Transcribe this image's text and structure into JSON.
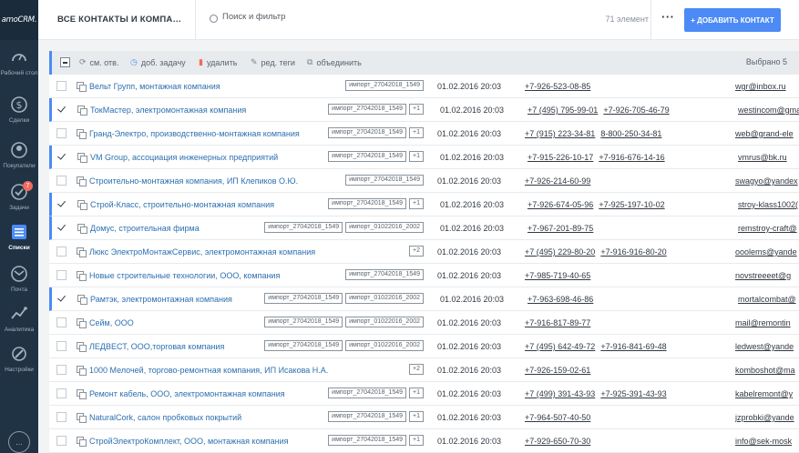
{
  "sidebar": {
    "logo": "amoCRM.",
    "items": [
      {
        "label": "Рабочий стол",
        "icon": "speedometer-icon"
      },
      {
        "label": "Сделки",
        "icon": "dollar-icon"
      },
      {
        "label": "Покупатели",
        "icon": "customer-icon"
      },
      {
        "label": "Задачи",
        "icon": "tasks-check-icon",
        "badge": "7"
      },
      {
        "label": "Списки",
        "icon": "lists-icon",
        "active": true
      },
      {
        "label": "Почта",
        "icon": "mail-icon"
      },
      {
        "label": "Аналитика",
        "icon": "analytics-icon"
      },
      {
        "label": "Настройки",
        "icon": "settings-icon"
      }
    ],
    "chat": "..."
  },
  "header": {
    "title": "ВСЕ КОНТАКТЫ И КОМПАНИИ",
    "search_placeholder": "Поиск и фильтр",
    "count": "71 элемент",
    "more": "···",
    "add_button": "+ ДОБАВИТЬ КОНТАКТ"
  },
  "actions": {
    "items": [
      {
        "label": "см. отв.",
        "icon": "refresh-icon"
      },
      {
        "label": "доб. задачу",
        "icon": "clock-icon"
      },
      {
        "label": "удалить",
        "icon": "trash-icon"
      },
      {
        "label": "ред. теги",
        "icon": "tag-icon"
      },
      {
        "label": "объединить",
        "icon": "merge-icon"
      }
    ],
    "selected": "Выбрано 5"
  },
  "rows": [
    {
      "name": "Вельт Групп, монтажная компания",
      "tags": [
        "импорт_27042018_1549"
      ],
      "date": "01.02.2016 20:03",
      "phones": [
        "+7-926-523-08-85"
      ],
      "email": "wgr@inbox.ru",
      "selected": false
    },
    {
      "name": "ТокМастер, электромонтажная компания",
      "tags": [
        "импорт_27042018_1549",
        "+1"
      ],
      "date": "01.02.2016 20:03",
      "phones": [
        "+7 (495) 795-99-01",
        "+7-926-705-46-79"
      ],
      "email": "westincom@gmail",
      "selected": true
    },
    {
      "name": "Гранд-Электро, производственно-монтажная компания",
      "tags": [
        "импорт_27042018_1549",
        "+1"
      ],
      "date": "01.02.2016 20:03",
      "phones": [
        "+7 (915) 223-34-81",
        "8-800-250-34-81"
      ],
      "email": "web@grand-ele",
      "selected": false
    },
    {
      "name": "VM Group, ассоциация инженерных предприятий",
      "tags": [
        "импорт_27042018_1549",
        "+1"
      ],
      "date": "01.02.2016 20:03",
      "phones": [
        "+7-915-226-10-17",
        "+7-916-676-14-16"
      ],
      "email": "vmrus@bk.ru",
      "selected": true
    },
    {
      "name": "Строительно-монтажная компания, ИП Клепиков О.Ю.",
      "tags": [
        "импорт_27042018_1549"
      ],
      "date": "01.02.2016 20:03",
      "phones": [
        "+7-926-214-60-99"
      ],
      "email": "swagyo@yandex",
      "selected": false
    },
    {
      "name": "Строй-Класс, строительно-монтажная компания",
      "tags": [
        "импорт_27042018_1549",
        "+1"
      ],
      "date": "01.02.2016 20:03",
      "phones": [
        "+7-926-674-05-96",
        "+7-925-197-10-02"
      ],
      "email": "stroy-klass1002(",
      "selected": true
    },
    {
      "name": "Домус, строительная фирма",
      "tags": [
        "импорт_27042018_1549",
        "импорт_01022016_2002"
      ],
      "date": "01.02.2016 20:03",
      "phones": [
        "+7-967-201-89-75"
      ],
      "email": "remstroy-craft@",
      "selected": true
    },
    {
      "name": "Люкс ЭлектроМонтажСервис, электромонтажная компания",
      "tags": [
        "+2"
      ],
      "date": "01.02.2016 20:03",
      "phones": [
        "+7 (495) 229-80-20",
        "+7-916-916-80-20"
      ],
      "email": "ooolems@yande",
      "selected": false
    },
    {
      "name": "Новые строительные технологии, ООО, компания",
      "tags": [
        "импорт_27042018_1549"
      ],
      "date": "01.02.2016 20:03",
      "phones": [
        "+7-985-719-40-65"
      ],
      "email": "novstreeeet@g",
      "selected": false
    },
    {
      "name": "Рамтэк, электромонтажная компания",
      "tags": [
        "импорт_27042018_1549",
        "импорт_01022016_2002"
      ],
      "date": "01.02.2016 20:03",
      "phones": [
        "+7-963-698-46-86"
      ],
      "email": "mortalcombat@",
      "selected": true
    },
    {
      "name": "Сейм, ООО",
      "tags": [
        "импорт_27042018_1549",
        "импорт_01022016_2002"
      ],
      "date": "01.02.2016 20:03",
      "phones": [
        "+7-916-817-89-77"
      ],
      "email": "mail@remontin",
      "selected": false
    },
    {
      "name": "ЛЕДВЕСТ, ООО,торговая компания",
      "tags": [
        "импорт_27042018_1549",
        "импорт_01022016_2002"
      ],
      "date": "01.02.2016 20:03",
      "phones": [
        "+7 (495) 642-49-72",
        "+7-916-841-69-48"
      ],
      "email": "ledwest@yande",
      "selected": false
    },
    {
      "name": "1000 Мелочей, торгово-ремонтная компания, ИП Исакова Н.А.",
      "tags": [
        "+2"
      ],
      "date": "01.02.2016 20:03",
      "phones": [
        "+7-926-159-02-61"
      ],
      "email": "komboshot@ma",
      "selected": false
    },
    {
      "name": "Ремонт кабель, ООО, электромонтажная компания",
      "tags": [
        "импорт_27042018_1549",
        "+1"
      ],
      "date": "01.02.2016 20:03",
      "phones": [
        "+7 (499) 391-43-93",
        "+7-925-391-43-93"
      ],
      "email": "kabelremont@y",
      "selected": false
    },
    {
      "name": "NaturalCork, салон пробковых покрытий",
      "tags": [
        "импорт_27042018_1549",
        "+1"
      ],
      "date": "01.02.2016 20:03",
      "phones": [
        "+7-964-507-40-50"
      ],
      "email": "jzprobki@yande",
      "selected": false
    },
    {
      "name": "СтройЭлектроКомплект, ООО, монтажная компания",
      "tags": [
        "импорт_27042018_1549",
        "+1"
      ],
      "date": "01.02.2016 20:03",
      "phones": [
        "+7-929-650-70-30"
      ],
      "email": "info@sek-mosk",
      "selected": false
    }
  ]
}
